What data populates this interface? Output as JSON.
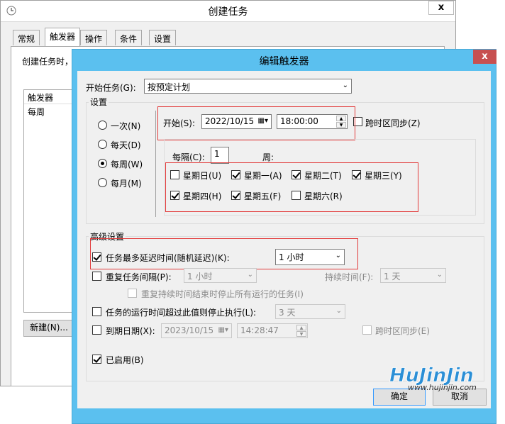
{
  "background_window": {
    "title": "创建任务",
    "close_label": "x",
    "tabs": [
      "常规",
      "触发器",
      "操作",
      "条件",
      "设置"
    ],
    "description": "创建任务时，",
    "list_header": "触发器",
    "list_row": "每周",
    "new_button": "新建(N)..."
  },
  "dialog": {
    "title": "编辑触发器",
    "close_label": "x",
    "begin_task_label": "开始任务(G):",
    "begin_task_value": "按预定计划",
    "settings_group": "设置",
    "schedule_options": [
      "一次(N)",
      "每天(D)",
      "每周(W)",
      "每月(M)"
    ],
    "selected_schedule": "每周(W)",
    "start_label": "开始(S):",
    "start_date": "2022/10/15",
    "start_time": "18:00:00",
    "sync_timezone_label": "跨时区同步(Z)",
    "recur_every_label": "每隔(C):",
    "recur_every_value": "1",
    "recur_unit": "周:",
    "weekdays": [
      {
        "label": "星期日(U)",
        "checked": false
      },
      {
        "label": "星期一(A)",
        "checked": true
      },
      {
        "label": "星期二(T)",
        "checked": true
      },
      {
        "label": "星期三(Y)",
        "checked": true
      },
      {
        "label": "星期四(H)",
        "checked": true
      },
      {
        "label": "星期五(F)",
        "checked": true
      },
      {
        "label": "星期六(R)",
        "checked": false
      }
    ],
    "advanced_group": "高级设置",
    "delay_label": "任务最多延迟时间(随机延迟)(K):",
    "delay_value": "1 小时",
    "repeat_label": "重复任务间隔(P):",
    "repeat_value": "1 小时",
    "duration_label": "持续时间(F):",
    "duration_value": "1 天",
    "stop_all_label": "重复持续时间结束时停止所有运行的任务(I)",
    "stop_longer_label": "任务的运行时间超过此值则停止执行(L):",
    "stop_longer_value": "3 天",
    "expire_label": "到期日期(X):",
    "expire_date": "2023/10/15",
    "expire_time": "14:28:47",
    "expire_sync_label": "跨时区同步(E)",
    "enabled_label": "已启用(B)",
    "ok_button": "确定",
    "cancel_button": "取消"
  },
  "watermark": {
    "logo_text": "HuJinJin",
    "url": "www.hujinjin.com"
  },
  "colors": {
    "dialog_frame": "#5bc0ef",
    "close_button": "#c75050",
    "highlight_box": "#e23b3b"
  }
}
